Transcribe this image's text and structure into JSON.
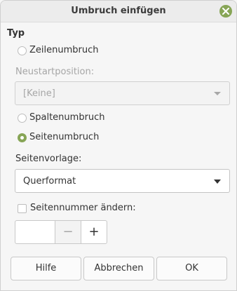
{
  "window": {
    "title": "Umbruch einfügen"
  },
  "type_section": {
    "label": "Typ"
  },
  "options": {
    "line_break": "Zeilenumbruch",
    "restart_label": "Neustartposition:",
    "restart_value": "[Keine]",
    "column_break": "Spaltenumbruch",
    "page_break": "Seitenumbruch"
  },
  "page_style": {
    "label": "Seitenvorlage:",
    "value": "Querformat"
  },
  "page_number": {
    "label": "Seitennummer ändern:",
    "value": "",
    "minus": "−",
    "plus": "+"
  },
  "buttons": {
    "help": "Hilfe",
    "cancel": "Abbrechen",
    "ok": "OK"
  },
  "colors": {
    "accent": "#87a556"
  }
}
